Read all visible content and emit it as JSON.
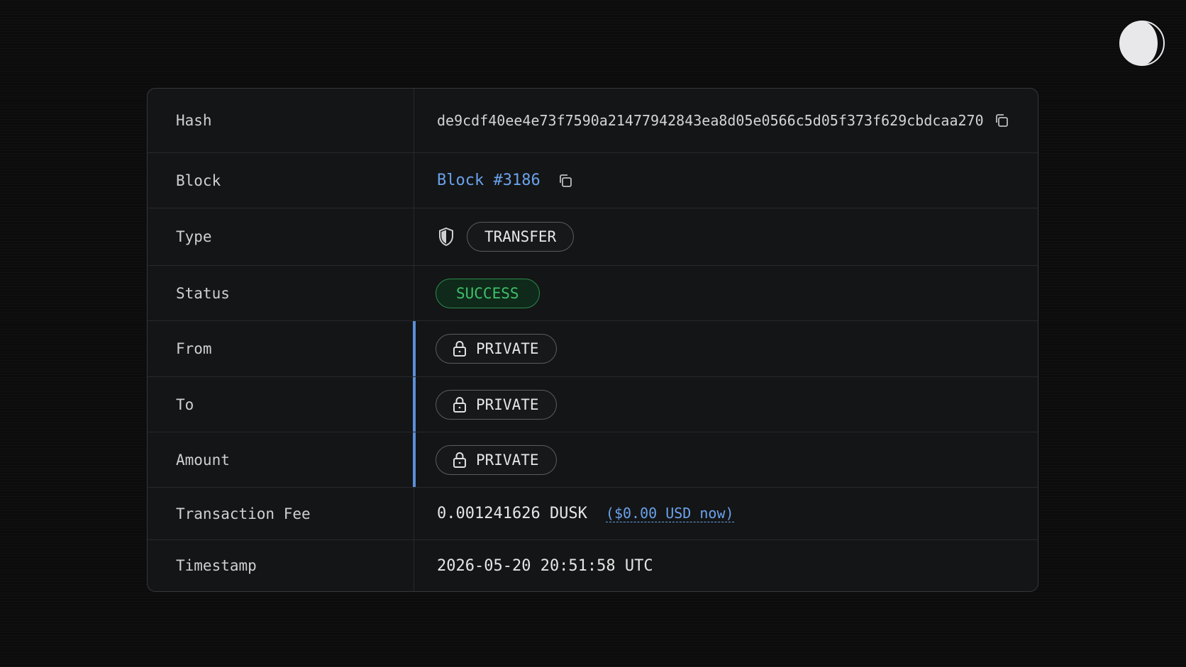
{
  "theme_toggle": {
    "icon": "half-moon-icon"
  },
  "rows": {
    "hash": {
      "label": "Hash",
      "value": "de9cdf40ee4e73f7590a21477942843ea8d05e0566c5d05f373f629cbdcaa270"
    },
    "block": {
      "label": "Block",
      "value": "Block #3186"
    },
    "type": {
      "label": "Type",
      "value": "TRANSFER"
    },
    "status": {
      "label": "Status",
      "value": "SUCCESS"
    },
    "from": {
      "label": "From",
      "value": "PRIVATE"
    },
    "to": {
      "label": "To",
      "value": "PRIVATE"
    },
    "amount": {
      "label": "Amount",
      "value": "PRIVATE"
    },
    "fee": {
      "label": "Transaction Fee",
      "value": "0.001241626 DUSK",
      "usd": "($0.00 USD now)"
    },
    "timestamp": {
      "label": "Timestamp",
      "value": "2026-05-20 20:51:58 UTC"
    }
  },
  "colors": {
    "background": "#0c0c0d",
    "card": "#141516",
    "link": "#6aa2ec",
    "success": "#3fbf6a",
    "accent_bar": "#5b8fd8"
  }
}
